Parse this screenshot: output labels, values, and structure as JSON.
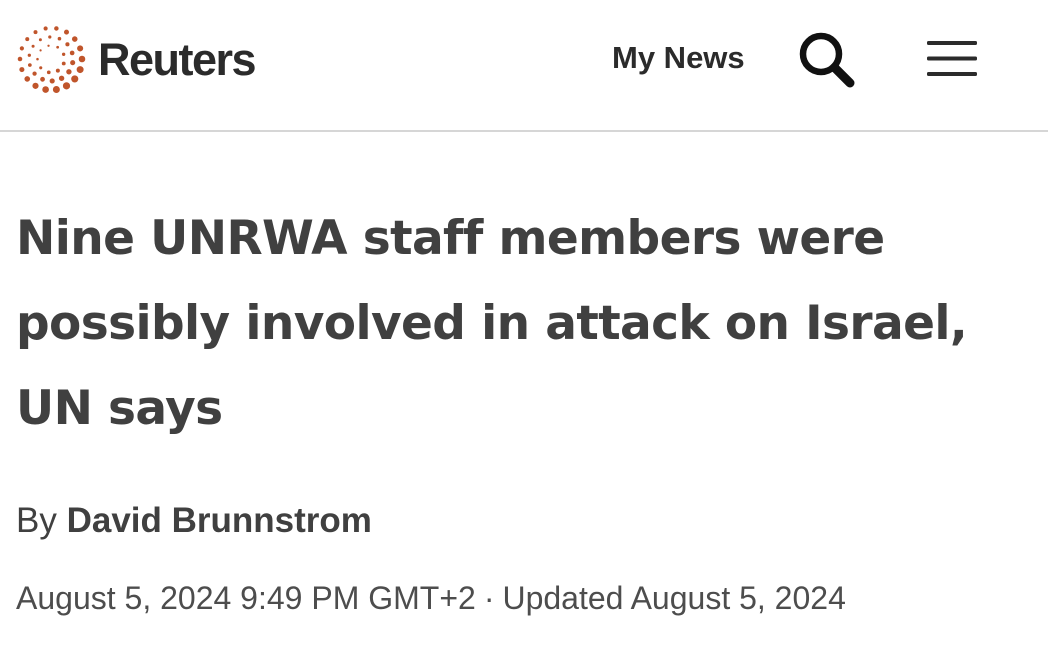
{
  "header": {
    "logo_icon": "reuters-dot-ring-icon",
    "brand_name": "Reuters",
    "brand_color": "#c0552b",
    "my_news_label": "My News",
    "search_icon": "search-icon",
    "menu_icon": "hamburger-menu-icon"
  },
  "article": {
    "headline": "Nine UNRWA staff members were possibly involved in attack on Israel, UN says",
    "byline_prefix": "By",
    "author": "David Brunnstrom",
    "published": "August 5, 2024 9:49 PM GMT+2",
    "separator": "·",
    "updated": "Updated August 5, 2024"
  },
  "colors": {
    "text": "#404040",
    "divider": "#d6d6d6",
    "background": "#ffffff"
  }
}
